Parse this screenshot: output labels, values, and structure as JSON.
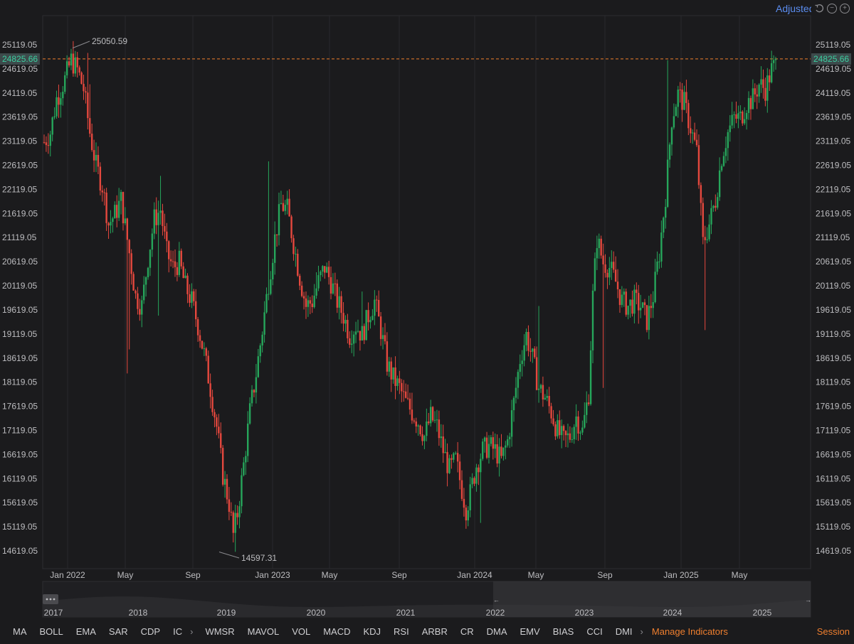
{
  "toolbar": {
    "adjust_label": "Adjusted",
    "undo_icon": "undo-icon",
    "zoom_out_icon": "zoom-out-icon",
    "zoom_in_icon": "zoom-in-icon"
  },
  "colors": {
    "background": "#1b1b1d",
    "up": "#26a65b",
    "down": "#e5483e",
    "accent": "#f07f2e",
    "link": "#5b8df0",
    "price_tag_text": "#3bd0a0"
  },
  "chart_data": {
    "type": "candlestick",
    "ylim": [
      14400,
      25350
    ],
    "y_ticks": [
      "25119.05",
      "24619.05",
      "24119.05",
      "23619.05",
      "23119.05",
      "22619.05",
      "22119.05",
      "21619.05",
      "21119.05",
      "20619.05",
      "20119.05",
      "19619.05",
      "19119.05",
      "18619.05",
      "18119.05",
      "17619.05",
      "17119.05",
      "16619.05",
      "16119.05",
      "15619.05",
      "15119.05",
      "14619.05"
    ],
    "x_ticks": [
      "Jan 2022",
      "May",
      "Sep",
      "Jan 2023",
      "May",
      "Sep",
      "Jan 2024",
      "May",
      "Sep",
      "Jan 2025",
      "May"
    ],
    "current_price": "24825.66",
    "high_annotation": "25050.59",
    "low_annotation": "14597.31",
    "trend": [
      [
        0,
        23100
      ],
      [
        3,
        23300
      ],
      [
        6,
        24000
      ],
      [
        10,
        24400
      ],
      [
        13,
        24800
      ],
      [
        16,
        24600
      ],
      [
        19,
        24200
      ],
      [
        22,
        23300
      ],
      [
        25,
        22600
      ],
      [
        28,
        22200
      ],
      [
        31,
        21400
      ],
      [
        34,
        21600
      ],
      [
        37,
        21900
      ],
      [
        41,
        20800
      ],
      [
        44,
        19900
      ],
      [
        47,
        19700
      ],
      [
        50,
        20700
      ],
      [
        53,
        21500
      ],
      [
        56,
        21700
      ],
      [
        59,
        20800
      ],
      [
        62,
        20500
      ],
      [
        65,
        20600
      ],
      [
        68,
        20100
      ],
      [
        71,
        19800
      ],
      [
        74,
        19300
      ],
      [
        77,
        18700
      ],
      [
        80,
        18000
      ],
      [
        83,
        17200
      ],
      [
        86,
        16200
      ],
      [
        89,
        15600
      ],
      [
        91,
        14950
      ],
      [
        93,
        15400
      ],
      [
        96,
        16400
      ],
      [
        99,
        17500
      ],
      [
        102,
        18300
      ],
      [
        105,
        19200
      ],
      [
        108,
        20200
      ],
      [
        111,
        21100
      ],
      [
        114,
        21800
      ],
      [
        117,
        21700
      ],
      [
        120,
        21000
      ],
      [
        123,
        20300
      ],
      [
        126,
        19700
      ],
      [
        129,
        19800
      ],
      [
        132,
        20200
      ],
      [
        135,
        20500
      ],
      [
        138,
        20200
      ],
      [
        141,
        19800
      ],
      [
        144,
        19500
      ],
      [
        147,
        19100
      ],
      [
        150,
        19300
      ],
      [
        153,
        19100
      ],
      [
        156,
        19500
      ],
      [
        159,
        19800
      ],
      [
        162,
        19200
      ],
      [
        165,
        18500
      ],
      [
        168,
        18200
      ],
      [
        171,
        18000
      ],
      [
        174,
        17700
      ],
      [
        177,
        17500
      ],
      [
        180,
        17300
      ],
      [
        183,
        17000
      ],
      [
        186,
        17400
      ],
      [
        189,
        17200
      ],
      [
        192,
        16700
      ],
      [
        195,
        16300
      ],
      [
        198,
        16500
      ],
      [
        201,
        15900
      ],
      [
        203,
        15500
      ],
      [
        205,
        15800
      ],
      [
        208,
        16400
      ],
      [
        211,
        16700
      ],
      [
        214,
        16800
      ],
      [
        217,
        16700
      ],
      [
        220,
        16500
      ],
      [
        223,
        16900
      ],
      [
        226,
        17700
      ],
      [
        229,
        18600
      ],
      [
        232,
        19100
      ],
      [
        235,
        18600
      ],
      [
        238,
        18000
      ],
      [
        241,
        17800
      ],
      [
        244,
        17500
      ],
      [
        247,
        17100
      ],
      [
        250,
        16900
      ],
      [
        253,
        17000
      ],
      [
        256,
        17400
      ],
      [
        259,
        17100
      ],
      [
        262,
        17900
      ],
      [
        264,
        19900
      ],
      [
        266,
        21100
      ],
      [
        269,
        20600
      ],
      [
        272,
        20500
      ],
      [
        275,
        20200
      ],
      [
        278,
        19800
      ],
      [
        281,
        19700
      ],
      [
        284,
        19800
      ],
      [
        287,
        19700
      ],
      [
        290,
        19400
      ],
      [
        293,
        19900
      ],
      [
        296,
        20800
      ],
      [
        299,
        22000
      ],
      [
        302,
        23600
      ],
      [
        305,
        24100
      ],
      [
        308,
        23900
      ],
      [
        311,
        23400
      ],
      [
        314,
        22900
      ],
      [
        317,
        21000
      ],
      [
        320,
        21400
      ],
      [
        323,
        21900
      ],
      [
        326,
        22800
      ],
      [
        329,
        23300
      ],
      [
        332,
        23600
      ],
      [
        335,
        23600
      ],
      [
        338,
        23900
      ],
      [
        341,
        24000
      ],
      [
        344,
        24300
      ],
      [
        347,
        24200
      ],
      [
        350,
        24600
      ],
      [
        352,
        24700
      ]
    ],
    "spikes": [
      [
        20,
        23900
      ],
      [
        21,
        24950
      ],
      [
        22,
        24300
      ],
      [
        36,
        22150
      ],
      [
        37,
        21600
      ],
      [
        40,
        18300
      ],
      [
        41,
        18800
      ],
      [
        55,
        19500
      ],
      [
        56,
        22400
      ],
      [
        65,
        20700
      ],
      [
        92,
        14600
      ],
      [
        106,
        19800
      ],
      [
        108,
        22700
      ],
      [
        117,
        21600
      ],
      [
        131,
        20400
      ],
      [
        153,
        20000
      ],
      [
        158,
        19400
      ],
      [
        159,
        19800
      ],
      [
        177,
        17900
      ],
      [
        210,
        15200
      ],
      [
        238,
        19700
      ],
      [
        269,
        18000
      ],
      [
        300,
        24800
      ],
      [
        305,
        23900
      ],
      [
        318,
        19200
      ],
      [
        320,
        21600
      ],
      [
        335,
        23600
      ],
      [
        350,
        24750
      ]
    ],
    "navigator": {
      "years": [
        "2017",
        "2018",
        "2019",
        "2020",
        "2021",
        "2022",
        "2023",
        "2024",
        "2025"
      ]
    }
  },
  "indicators": {
    "overlay": [
      "MA",
      "BOLL",
      "EMA",
      "SAR",
      "CDP",
      "IC"
    ],
    "sub": [
      "WMSR",
      "MAVOL",
      "VOL",
      "MACD",
      "KDJ",
      "RSI",
      "ARBR",
      "CR",
      "DMA",
      "EMV",
      "BIAS",
      "CCI",
      "DMI"
    ],
    "manage_label": "Manage Indicators",
    "session_label": "Session"
  }
}
